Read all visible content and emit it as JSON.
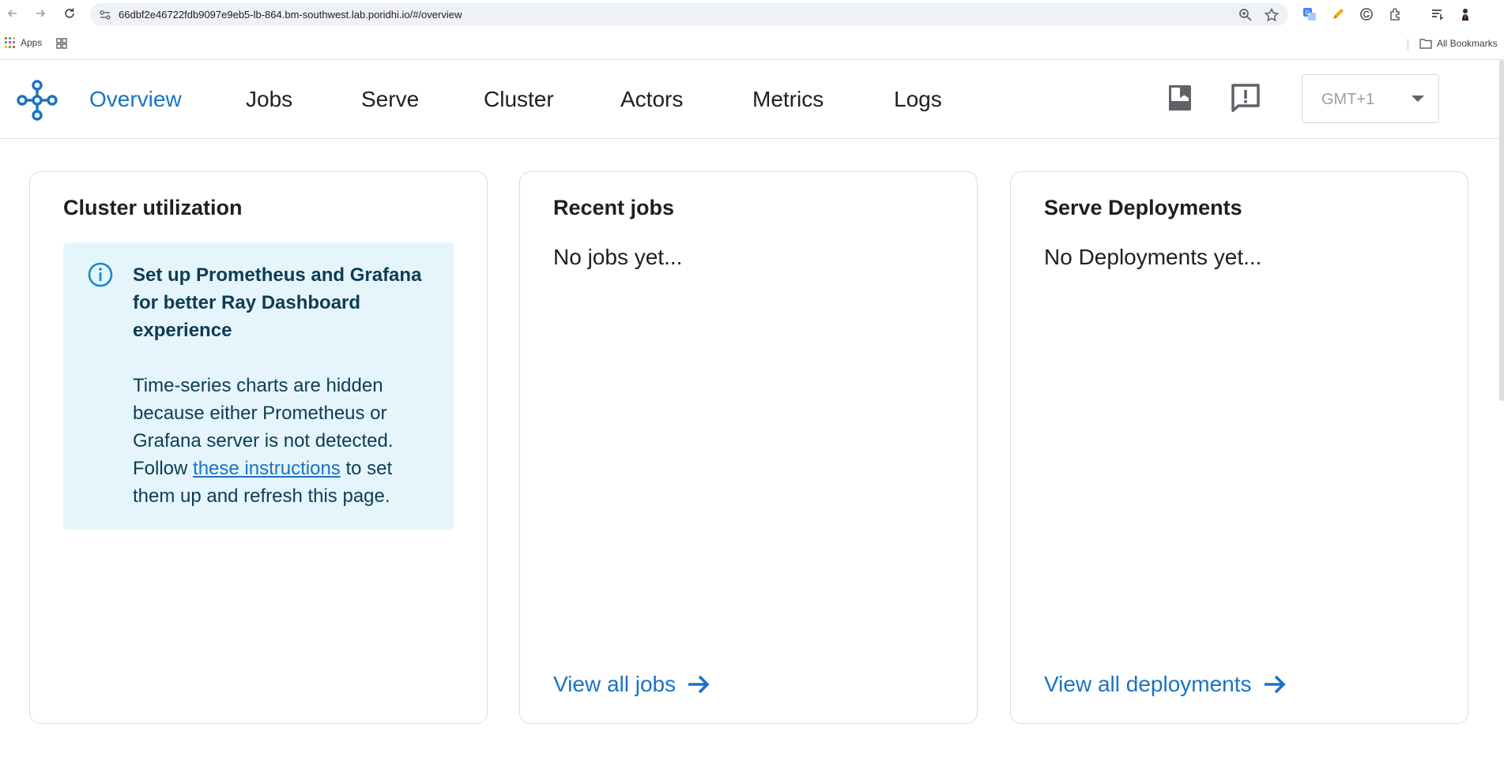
{
  "browser": {
    "url": "66dbf2e46722fdb9097e9eb5-lb-864.bm-southwest.lab.poridhi.io/#/overview",
    "bookmarks": {
      "apps_label": "Apps",
      "all_bookmarks_label": "All Bookmarks"
    }
  },
  "header": {
    "tabs": [
      {
        "label": "Overview",
        "active": true
      },
      {
        "label": "Jobs"
      },
      {
        "label": "Serve"
      },
      {
        "label": "Cluster"
      },
      {
        "label": "Actors"
      },
      {
        "label": "Metrics"
      },
      {
        "label": "Logs"
      }
    ],
    "timezone": "GMT+1",
    "accent_color": "#1a73c4"
  },
  "cards": {
    "cluster": {
      "title": "Cluster utilization",
      "alert": {
        "title": "Set up Prometheus and Grafana for better Ray Dashboard experience",
        "body_before": "Time-series charts are hidden because either Prometheus or Grafana server is not detected. Follow ",
        "link_text": "these instructions",
        "body_after": " to set them up and refresh this page.",
        "icon": "info-icon",
        "background": "#e5f5fb"
      }
    },
    "jobs": {
      "title": "Recent jobs",
      "empty_text": "No jobs yet...",
      "link_text": "View all jobs"
    },
    "deployments": {
      "title": "Serve Deployments",
      "empty_text": "No Deployments yet...",
      "link_text": "View all deployments"
    }
  }
}
